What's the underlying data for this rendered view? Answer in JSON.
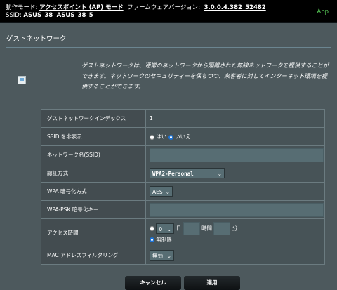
{
  "topbar": {
    "mode_label": "動作モード:",
    "mode_value": "アクセスポイント (AP) モード",
    "fw_label": "ファームウェアバージョン:",
    "fw_value": "3.0.0.4.382_52482",
    "ssid_label": "SSID:",
    "ssid_1": "ASUS_38",
    "ssid_2": "ASUS_38_5",
    "app": "App"
  },
  "page": {
    "title": "ゲストネットワーク",
    "description": "ゲストネットワークは、通常のネットワークから隔離された無線ネットワークを提供することができます。ネットワークのセキュリティーを保ちつつ、来客者に対してインターネット環境を提供することができます。"
  },
  "form": {
    "index_label": "ゲストネットワークインデックス",
    "index_value": "1",
    "hide_ssid_label": "SSID を非表示",
    "yes": "はい",
    "no": "いいえ",
    "network_name_label": "ネットワーク名(SSID)",
    "network_name_value": "",
    "auth_label": "認証方式",
    "auth_value": "WPA2-Personal",
    "wpa_enc_label": "WPA 暗号化方式",
    "wpa_enc_value": "AES",
    "psk_label": "WPA-PSK 暗号化キー",
    "psk_value": "",
    "access_time_label": "アクセス時間",
    "days_value": "0",
    "day_unit": "日",
    "hour_unit": "時間",
    "minute_unit": "分",
    "unlimited": "無制限",
    "mac_filter_label": "MAC アドレスフィルタリング",
    "mac_filter_value": "無効"
  },
  "buttons": {
    "cancel": "キャンセル",
    "apply": "適用"
  },
  "colors": {
    "panel_bg": "#4d595d",
    "accent": "#1f74d6",
    "app_green": "#5cd65c"
  }
}
